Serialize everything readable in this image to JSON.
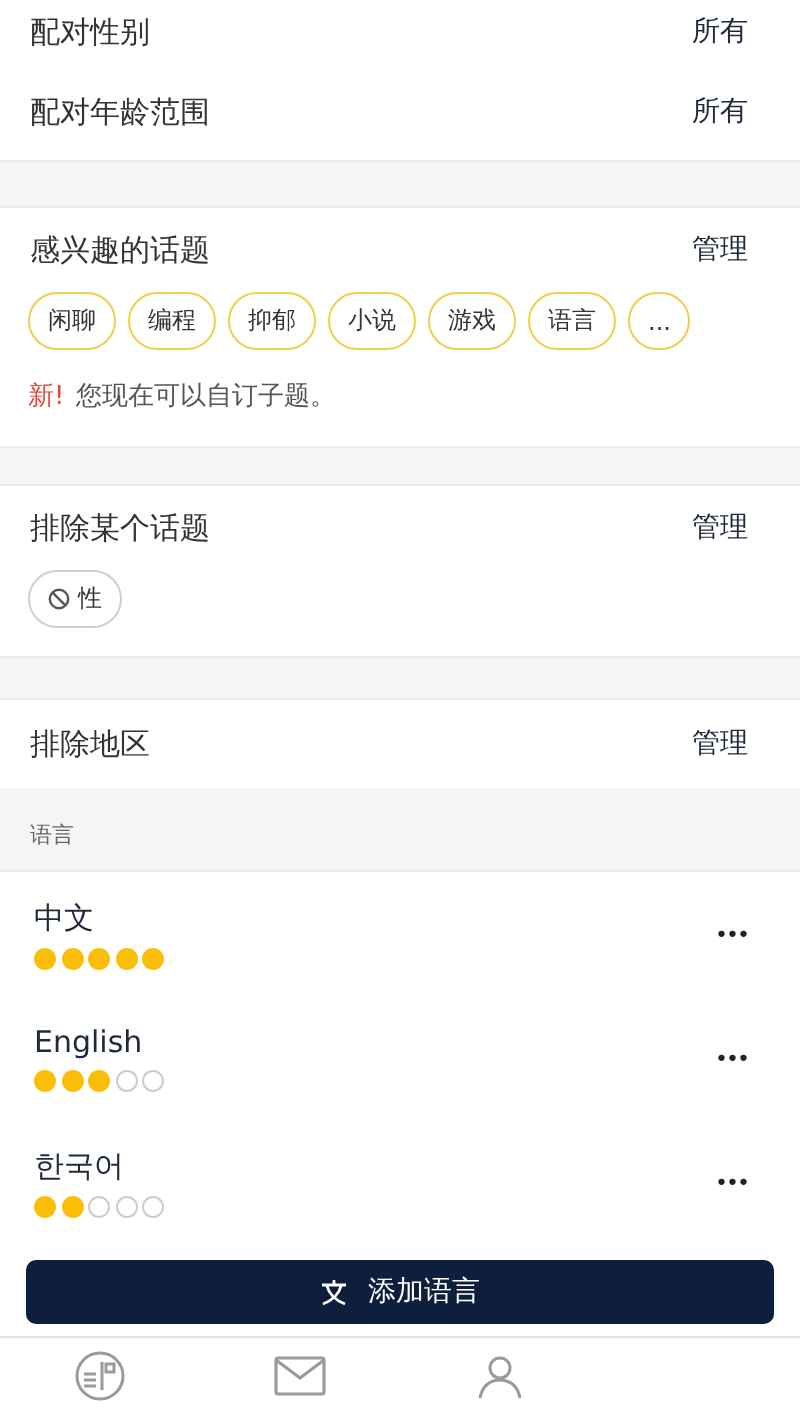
{
  "match_settings": [
    {
      "label": "配对性别",
      "value": "所有"
    },
    {
      "label": "配对年龄范围",
      "value": "所有"
    }
  ],
  "interest_topics": {
    "title": "感兴趣的话题",
    "action": "管理",
    "tags": [
      "闲聊",
      "编程",
      "抑郁",
      "小说",
      "游戏",
      "语言",
      "..."
    ],
    "notice_badge": "新!",
    "notice": "您现在可以自订子题。"
  },
  "excluded_topics": {
    "title": "排除某个话题",
    "action": "管理",
    "tags": [
      "性"
    ]
  },
  "excluded_regions": {
    "title": "排除地区",
    "action": "管理"
  },
  "languages_header": "语言",
  "languages": [
    {
      "name": "中文",
      "stars": 5,
      "menu": "•••"
    },
    {
      "name": "English",
      "stars": 3,
      "menu": "•••"
    },
    {
      "name": "한국어",
      "stars": 2,
      "menu": "•••"
    }
  ],
  "add_language_button": "添加语言",
  "tab_bar": [
    {
      "kind": "card",
      "selected": false
    },
    {
      "kind": "mail",
      "selected": false
    },
    {
      "kind": "person",
      "selected": false
    }
  ]
}
